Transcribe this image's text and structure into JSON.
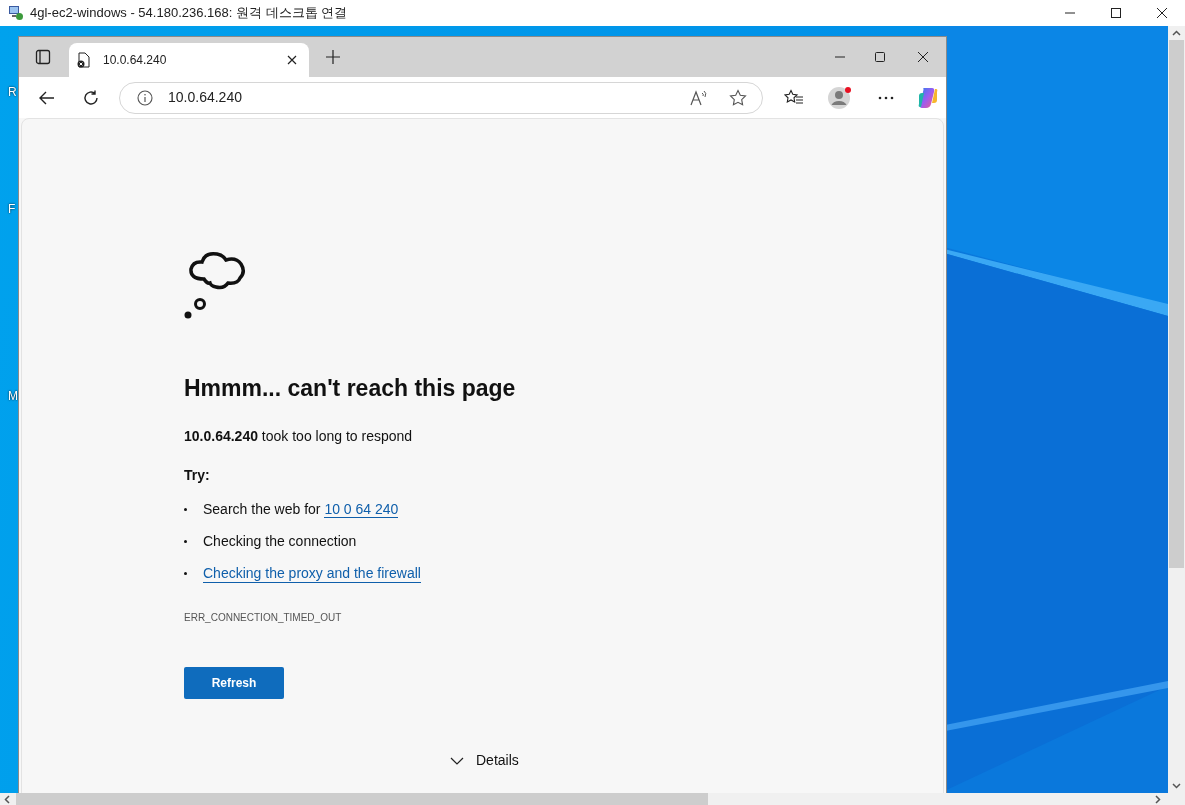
{
  "rdp_window": {
    "title": "4gl-ec2-windows - 54.180.236.168: 원격 데스크톱 연결"
  },
  "desktop_icons": [
    {
      "label": "R"
    },
    {
      "label": "F"
    },
    {
      "label": "M"
    }
  ],
  "browser": {
    "tabs": [
      {
        "title": "10.0.64.240",
        "selected": true
      }
    ],
    "address": "10.0.64.240",
    "error_page": {
      "heading": "Hmmm... can't reach this page",
      "message_host": "10.0.64.240",
      "message_rest": "took too long to respond",
      "try_label": "Try:",
      "suggestions": [
        {
          "kind": "search",
          "text": "Search the web for",
          "link": "10 0 64 240"
        },
        {
          "kind": "plain",
          "text": "Checking the connection"
        },
        {
          "kind": "link",
          "link": "Checking the proxy and the firewall"
        }
      ],
      "error_code": "ERR_CONNECTION_TIMED_OUT",
      "button": "Refresh",
      "details": "Details"
    }
  }
}
